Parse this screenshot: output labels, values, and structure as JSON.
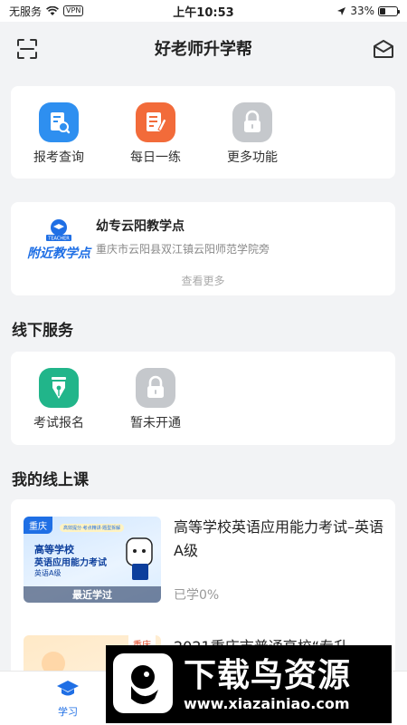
{
  "status_bar": {
    "carrier": "无服务",
    "vpn": "VPN",
    "time": "上午10:53",
    "battery": "33%",
    "battery_level": 0.33
  },
  "nav": {
    "title": "好老师升学帮",
    "left_icon": "scan-icon",
    "right_icon": "mail-icon"
  },
  "functions": [
    {
      "label": "报考查询",
      "icon": "exam-query-icon",
      "color": "#2e8ff0"
    },
    {
      "label": "每日一练",
      "icon": "daily-practice-icon",
      "color": "#f26b3a"
    },
    {
      "label": "更多功能",
      "icon": "lock-icon",
      "color": "#c5c8cc"
    }
  ],
  "nearby": {
    "logo_text": "附近教学点",
    "logo_badge": "TEACHER",
    "title": "幼专云阳教学点",
    "address": "重庆市云阳县双江镇云阳师范学院旁",
    "more": "查看更多"
  },
  "offline": {
    "section_title": "线下服务",
    "items": [
      {
        "label": "考试报名",
        "icon": "pen-icon",
        "color": "#21b58a"
      },
      {
        "label": "暂未开通",
        "icon": "lock-icon",
        "color": "#c5c8cc"
      }
    ]
  },
  "online": {
    "section_title": "我的线上课",
    "courses": [
      {
        "title": "高等学校英语应用能力考试–英语A级",
        "progress": "已学0%",
        "thumb": {
          "region": "重庆",
          "banner": "高效提分·考点精讲·题型拆解",
          "line1": "高等学校",
          "line2": "英语应用能力考试",
          "line3": "英语A级",
          "badge": "最近学过"
        }
      },
      {
        "title": "2021重庆市普通高校“专升",
        "thumb": {
          "region": "重庆"
        }
      }
    ]
  },
  "tab_bar": {
    "active_label": "学习",
    "active_color": "#1f6fe5"
  },
  "watermark": {
    "title": "下载鸟资源",
    "url": "www.xiazainiao.com"
  }
}
